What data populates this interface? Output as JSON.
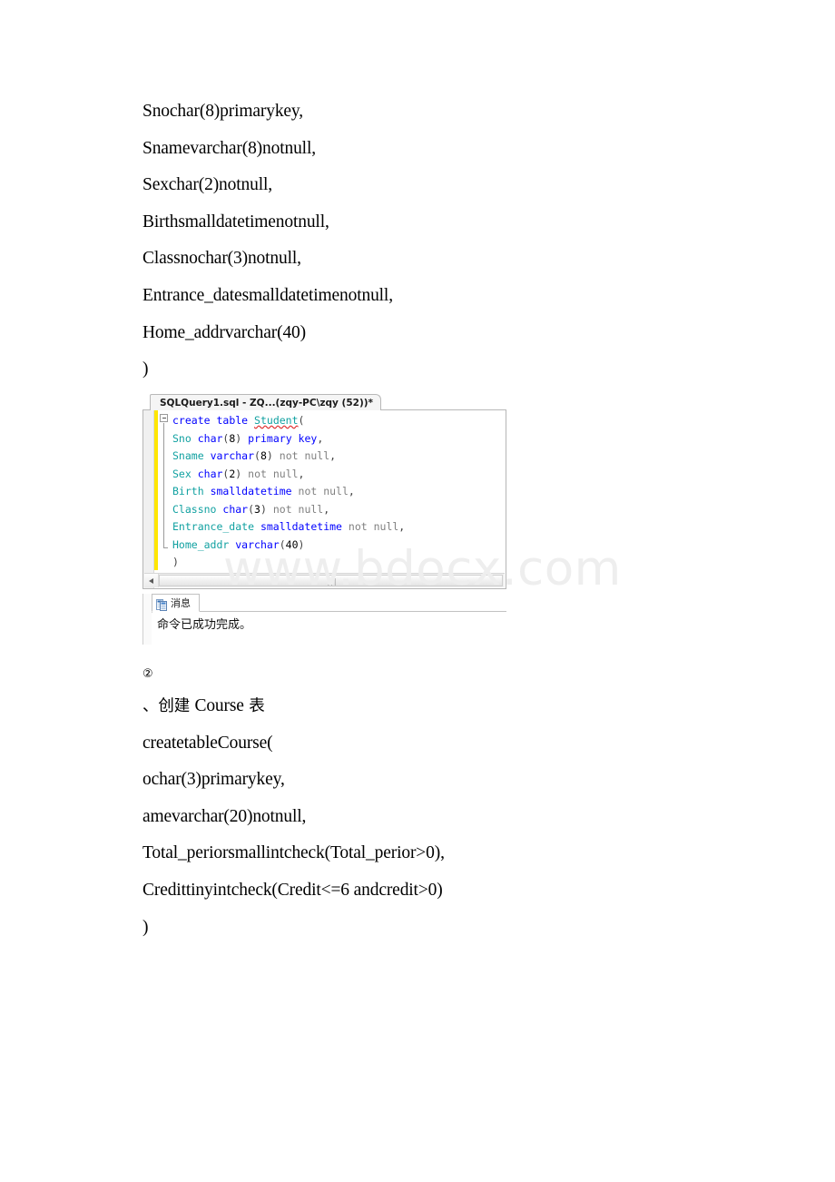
{
  "document": {
    "top_lines": [
      "Snochar(8)primarykey,",
      "Snamevarchar(8)notnull,",
      "Sexchar(2)notnull,",
      "Birthsmalldatetimenotnull,",
      "Classnochar(3)notnull,",
      "Entrance_datesmalldatetimenotnull,",
      "Home_addrvarchar(40)",
      ")"
    ],
    "section_marker": "②",
    "section_heading_cjk_lead": "、创建 ",
    "section_heading_latin": "Course",
    "section_heading_cjk_tail": " 表",
    "bottom_lines": [
      "createtableCourse(",
      "ochar(3)primarykey,",
      "amevarchar(20)notnull,",
      "Total_periorsmallintcheck(Total_perior>0),",
      "Credittinyintcheck(Credit<=6 andcredit>0)",
      ")"
    ]
  },
  "watermark": {
    "text": "www.bdocx.com",
    "color": "#eeeeee"
  },
  "ssms": {
    "tab": {
      "label": "SQLQuery1.sql - ZQ...(zqy-PC\\zqy (52))*"
    },
    "editor": {
      "change_bar_color": "#ffe600",
      "colors": {
        "keyword": "#0000ff",
        "identifier": "#11a1a1",
        "gray": "#808080",
        "squiggle": "#e03030"
      },
      "lines": [
        {
          "tokens": [
            {
              "t": "create",
              "c": "keyword"
            },
            {
              "t": " ",
              "c": "plain"
            },
            {
              "t": "table",
              "c": "keyword"
            },
            {
              "t": " ",
              "c": "plain"
            },
            {
              "t": "Student",
              "c": "squiggle"
            },
            {
              "t": "(",
              "c": "plain"
            }
          ]
        },
        {
          "tokens": [
            {
              "t": "Sno",
              "c": "identifier"
            },
            {
              "t": " ",
              "c": "plain"
            },
            {
              "t": "char",
              "c": "keyword"
            },
            {
              "t": "(",
              "c": "plain"
            },
            {
              "t": "8",
              "c": "number"
            },
            {
              "t": ") ",
              "c": "plain"
            },
            {
              "t": "primary key",
              "c": "keyword"
            },
            {
              "t": ",",
              "c": "plain"
            }
          ]
        },
        {
          "tokens": [
            {
              "t": "Sname",
              "c": "identifier"
            },
            {
              "t": " ",
              "c": "plain"
            },
            {
              "t": "varchar",
              "c": "keyword"
            },
            {
              "t": "(",
              "c": "plain"
            },
            {
              "t": "8",
              "c": "number"
            },
            {
              "t": ") ",
              "c": "plain"
            },
            {
              "t": "not null",
              "c": "gray"
            },
            {
              "t": ",",
              "c": "plain"
            }
          ]
        },
        {
          "tokens": [
            {
              "t": "Sex",
              "c": "identifier"
            },
            {
              "t": " ",
              "c": "plain"
            },
            {
              "t": "char",
              "c": "keyword"
            },
            {
              "t": "(",
              "c": "plain"
            },
            {
              "t": "2",
              "c": "number"
            },
            {
              "t": ") ",
              "c": "plain"
            },
            {
              "t": "not null",
              "c": "gray"
            },
            {
              "t": ",",
              "c": "plain"
            }
          ]
        },
        {
          "tokens": [
            {
              "t": "Birth",
              "c": "identifier"
            },
            {
              "t": " ",
              "c": "plain"
            },
            {
              "t": "smalldatetime",
              "c": "keyword"
            },
            {
              "t": " ",
              "c": "plain"
            },
            {
              "t": "not null",
              "c": "gray"
            },
            {
              "t": ",",
              "c": "plain"
            }
          ]
        },
        {
          "tokens": [
            {
              "t": "Classno",
              "c": "identifier"
            },
            {
              "t": " ",
              "c": "plain"
            },
            {
              "t": "char",
              "c": "keyword"
            },
            {
              "t": "(",
              "c": "plain"
            },
            {
              "t": "3",
              "c": "number"
            },
            {
              "t": ") ",
              "c": "plain"
            },
            {
              "t": "not null",
              "c": "gray"
            },
            {
              "t": ",",
              "c": "plain"
            }
          ]
        },
        {
          "tokens": [
            {
              "t": "Entrance_date",
              "c": "identifier"
            },
            {
              "t": " ",
              "c": "plain"
            },
            {
              "t": "smalldatetime",
              "c": "keyword"
            },
            {
              "t": " ",
              "c": "plain"
            },
            {
              "t": "not null",
              "c": "gray"
            },
            {
              "t": ",",
              "c": "plain"
            }
          ]
        },
        {
          "tokens": [
            {
              "t": "Home_addr",
              "c": "identifier"
            },
            {
              "t": " ",
              "c": "plain"
            },
            {
              "t": "varchar",
              "c": "keyword"
            },
            {
              "t": "(",
              "c": "plain"
            },
            {
              "t": "40",
              "c": "number"
            },
            {
              "t": ")",
              "c": "plain"
            }
          ]
        },
        {
          "tokens": [
            {
              "t": ")",
              "c": "plain"
            }
          ]
        }
      ]
    },
    "results": {
      "tab_label": "消息",
      "tab_icon": "messages-grid-icon",
      "message": "命令已成功完成。"
    },
    "scrollbar": {
      "left_arrow_icon": "chevron-left-icon",
      "grip_icon": "grip-dots-icon"
    }
  }
}
